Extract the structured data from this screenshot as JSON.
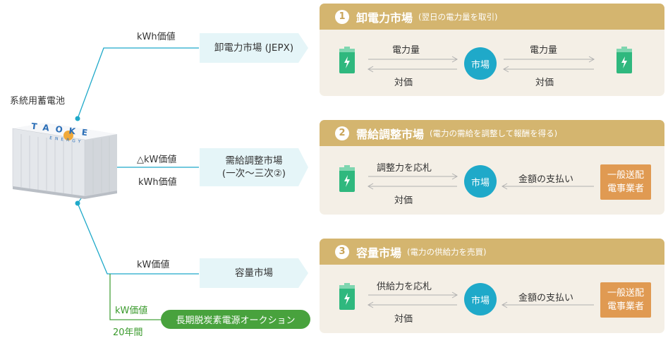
{
  "left": {
    "battery_system_label": "系統用蓄電池",
    "container_logo": "TAOKE",
    "container_logo_sub": "ENERGY",
    "value1": "kWh価値",
    "value2a": "△kW価値",
    "value2b": "kWh価値",
    "value3": "kW価値",
    "value4": "kW価値",
    "value4_years": "20年間",
    "target1": "卸電力市場 (JEPX)",
    "target2_line1": "需給調整市場",
    "target2_line2": "(一次～三次②)",
    "target3": "容量市場",
    "target4": "長期脱炭素電源オークション"
  },
  "panels": [
    {
      "num": "1",
      "title": "卸電力市場",
      "subtitle": "(翌日の電力量を取引)",
      "market": "市場",
      "top_left": "電力量",
      "bottom_left": "対価",
      "top_right": "電力量",
      "bottom_right": "対価"
    },
    {
      "num": "2",
      "title": "需給調整市場",
      "subtitle": "(電力の需給を調整して報酬を得る)",
      "market": "市場",
      "top_left": "調整力を応札",
      "bottom_left": "対価",
      "right": "金額の支払い",
      "operator_line1": "一般送配",
      "operator_line2": "電事業者"
    },
    {
      "num": "3",
      "title": "容量市場",
      "subtitle": "(電力の供給力を売買)",
      "market": "市場",
      "top_left": "供給力を応札",
      "bottom_left": "対価",
      "right": "金額の支払い",
      "operator_line1": "一般送配",
      "operator_line2": "電事業者"
    }
  ],
  "colors": {
    "connector": "#1fa9c9",
    "long_term_green": "#48a23d",
    "panel_header": "#d4b56f",
    "panel_bg": "#f4efe6",
    "market_circle": "#1fa9c9",
    "operator_box": "#e09a52",
    "battery_green": "#2fb87e"
  }
}
